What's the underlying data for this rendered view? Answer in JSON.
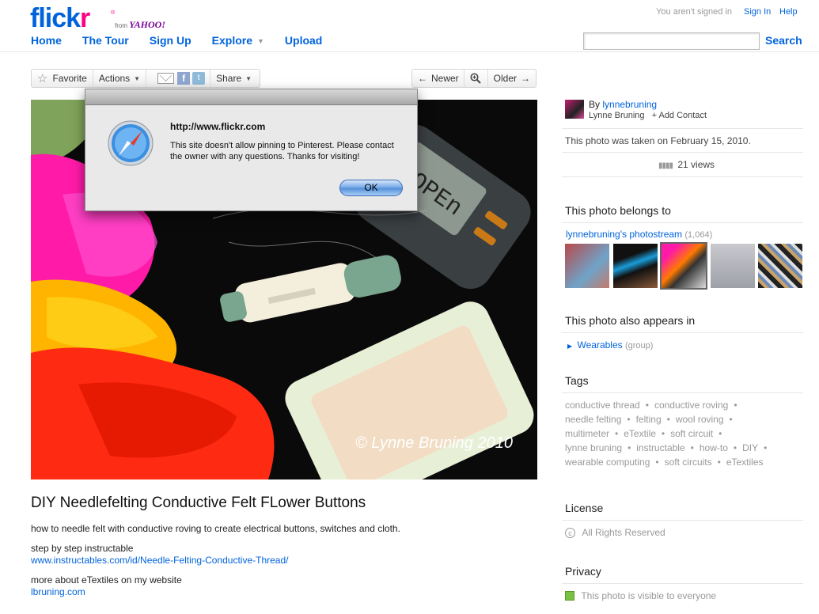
{
  "header": {
    "logo_a": "flick",
    "logo_b": "r",
    "logo_reg": "®",
    "from": "from",
    "yahoo": "YAHOO!",
    "nav": [
      "Home",
      "The Tour",
      "Sign Up",
      "Explore",
      "Upload"
    ],
    "signed_status": "You aren't signed in",
    "signin": "Sign In",
    "help": "Help",
    "search_button": "Search"
  },
  "toolbar": {
    "favorite": "Favorite",
    "actions": "Actions",
    "share": "Share",
    "newer": "Newer",
    "older": "Older",
    "newer_arrow": "←",
    "older_arrow": "→"
  },
  "dialog": {
    "title": "http://www.flickr.com",
    "message": "This site doesn't allow pinning to Pinterest. Please contact the owner with any questions. Thanks for visiting!",
    "ok": "OK"
  },
  "photo": {
    "watermark": "© Lynne Bruning 2010",
    "meter_text": "OPEn"
  },
  "details": {
    "title": "DIY Needlefelting Conductive Felt FLower Buttons",
    "description": "how to needle felt with conductive roving to create electrical buttons, switches and cloth.",
    "step_label": "step by step instructable",
    "step_link": "www.instructables.com/id/Needle-Felting-Conductive-Thread/",
    "more_label": "more about eTextiles on my website",
    "more_link": "lbruning.com"
  },
  "sidebar": {
    "by": "By",
    "username": "lynnebruning",
    "realname": "Lynne Bruning",
    "add_contact": "+ Add Contact",
    "taken": "This photo was taken on February 15, 2010.",
    "views": "21 views",
    "belongs_heading": "This photo belongs to",
    "photostream": "lynnebruning's photostream",
    "photostream_count": "(1,064)",
    "appears_heading": "This photo also appears in",
    "group": "Wearables",
    "group_tag": "(group)",
    "tags_heading": "Tags",
    "tag_rows": [
      [
        "conductive thread",
        "conductive roving"
      ],
      [
        "needle felting",
        "felting",
        "wool roving"
      ],
      [
        "multimeter",
        "eTextile",
        "soft circuit"
      ],
      [
        "lynne bruning",
        "instructable",
        "how-to",
        "DIY"
      ],
      [
        "wearable computing",
        "soft circuits",
        "eTextiles"
      ]
    ],
    "license_heading": "License",
    "license": "All Rights Reserved",
    "privacy_heading": "Privacy",
    "privacy": "This photo is visible to everyone"
  },
  "colors": {
    "link": "#0063dc",
    "flickr_pink": "#ff0084",
    "privacy_green": "#7ac143"
  }
}
